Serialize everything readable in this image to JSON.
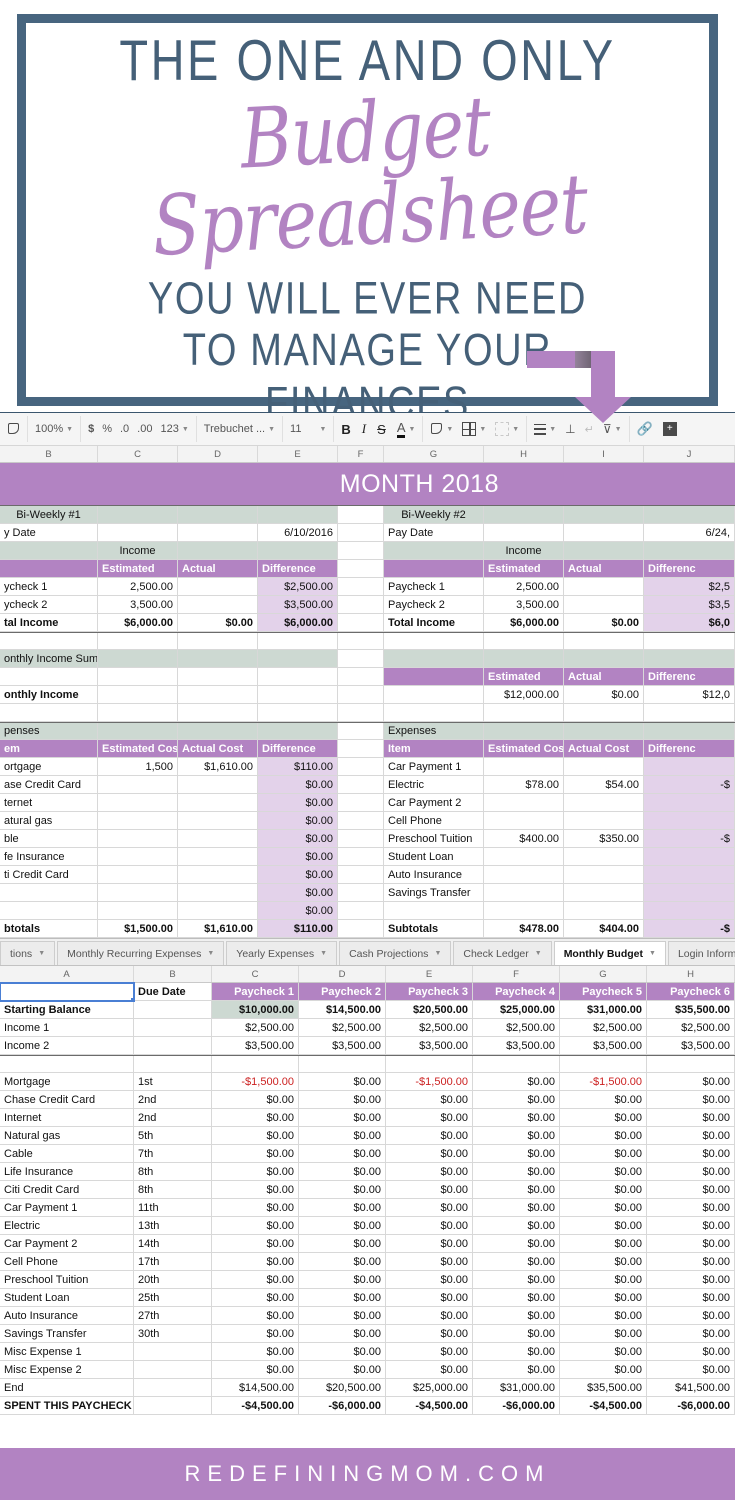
{
  "hero": {
    "line1": "THE ONE AND ONLY",
    "script": "Budget Spreadsheet",
    "line3_a": "YOU WILL EVER NEED",
    "line3_b": "TO MANAGE YOUR",
    "line3_c": "FINANCES"
  },
  "colors": {
    "accent_purple": "#b283c2",
    "light_purple": "#e3d2ea",
    "sage": "#cdd9d2",
    "navy": "#47657f",
    "negative_red": "#cc2222"
  },
  "toolbar": {
    "zoom": "100%",
    "currency": "$",
    "percent": "%",
    "dec_decrease": ".0",
    "dec_increase": ".00",
    "number_format": "123",
    "font": "Trebuchet ...",
    "font_size": "11",
    "bold": "B",
    "italic": "I",
    "strikethrough": "S",
    "text_color": "A"
  },
  "top_sheet": {
    "column_headers": [
      "B",
      "C",
      "D",
      "E",
      "F",
      "G",
      "H",
      "I",
      "J"
    ],
    "banner_title": "MONTH 2018",
    "left": {
      "section_title": "Bi-Weekly #1",
      "pay_date_label": "y Date",
      "pay_date_value": "6/10/2016",
      "income_label": "Income",
      "income_headers": [
        "Estimated",
        "Actual",
        "Difference"
      ],
      "income_rows": [
        {
          "item": "ycheck 1",
          "estimated": "2,500.00",
          "actual": "",
          "difference": "$2,500.00"
        },
        {
          "item": "ycheck 2",
          "estimated": "3,500.00",
          "actual": "",
          "difference": "$3,500.00"
        },
        {
          "item": "tal Income",
          "estimated": "$6,000.00",
          "actual": "$0.00",
          "difference": "$6,000.00"
        }
      ],
      "summary_title": "onthly Income Summary",
      "summary_label": "onthly Income",
      "expenses_title": "penses",
      "expense_headers": [
        "em",
        "Estimated Cost",
        "Actual Cost",
        "Difference"
      ],
      "expense_rows": [
        {
          "item": "ortgage",
          "estimated": "1,500",
          "actual": "$1,610.00",
          "difference": "$110.00"
        },
        {
          "item": "ase Credit Card",
          "estimated": "",
          "actual": "",
          "difference": "$0.00"
        },
        {
          "item": "ternet",
          "estimated": "",
          "actual": "",
          "difference": "$0.00"
        },
        {
          "item": "atural gas",
          "estimated": "",
          "actual": "",
          "difference": "$0.00"
        },
        {
          "item": "ble",
          "estimated": "",
          "actual": "",
          "difference": "$0.00"
        },
        {
          "item": "fe Insurance",
          "estimated": "",
          "actual": "",
          "difference": "$0.00"
        },
        {
          "item": "ti Credit Card",
          "estimated": "",
          "actual": "",
          "difference": "$0.00"
        },
        {
          "item": "",
          "estimated": "",
          "actual": "",
          "difference": "$0.00"
        },
        {
          "item": "",
          "estimated": "",
          "actual": "",
          "difference": "$0.00"
        }
      ],
      "subtotal_row": {
        "item": "btotals",
        "estimated": "$1,500.00",
        "actual": "$1,610.00",
        "difference": "$110.00"
      }
    },
    "right": {
      "section_title": "Bi-Weekly #2",
      "pay_date_label": "Pay Date",
      "pay_date_value": "6/24,",
      "income_label": "Income",
      "income_headers": [
        "Estimated",
        "Actual",
        "Differenc"
      ],
      "income_rows": [
        {
          "item": "Paycheck 1",
          "estimated": "2,500.00",
          "actual": "",
          "difference": "$2,5"
        },
        {
          "item": "Paycheck 2",
          "estimated": "3,500.00",
          "actual": "",
          "difference": "$3,5"
        },
        {
          "item": "Total Income",
          "estimated": "$6,000.00",
          "actual": "$0.00",
          "difference": "$6,0"
        }
      ],
      "summary_headers": [
        "Estimated",
        "Actual",
        "Differenc"
      ],
      "summary_values": {
        "estimated": "$12,000.00",
        "actual": "$0.00",
        "difference": "$12,0"
      },
      "expenses_title": "Expenses",
      "expense_headers": [
        "Item",
        "Estimated Cost",
        "Actual Cost",
        "Differenc"
      ],
      "expense_rows": [
        {
          "item": "Car Payment 1",
          "estimated": "",
          "actual": "",
          "difference": ""
        },
        {
          "item": "Electric",
          "estimated": "$78.00",
          "actual": "$54.00",
          "difference": "-$"
        },
        {
          "item": "Car Payment 2",
          "estimated": "",
          "actual": "",
          "difference": ""
        },
        {
          "item": "Cell Phone",
          "estimated": "",
          "actual": "",
          "difference": ""
        },
        {
          "item": "Preschool Tuition",
          "estimated": "$400.00",
          "actual": "$350.00",
          "difference": "-$"
        },
        {
          "item": "Student Loan",
          "estimated": "",
          "actual": "",
          "difference": ""
        },
        {
          "item": "Auto Insurance",
          "estimated": "",
          "actual": "",
          "difference": ""
        },
        {
          "item": "Savings Transfer",
          "estimated": "",
          "actual": "",
          "difference": ""
        },
        {
          "item": "",
          "estimated": "",
          "actual": "",
          "difference": ""
        }
      ],
      "subtotal_row": {
        "item": "Subtotals",
        "estimated": "$478.00",
        "actual": "$404.00",
        "difference": "-$"
      }
    }
  },
  "tabs": [
    {
      "label": "tions",
      "active": false
    },
    {
      "label": "Monthly Recurring Expenses",
      "active": false
    },
    {
      "label": "Yearly Expenses",
      "active": false
    },
    {
      "label": "Cash Projections",
      "active": false
    },
    {
      "label": "Check Ledger",
      "active": false
    },
    {
      "label": "Monthly Budget",
      "active": true
    },
    {
      "label": "Login Information",
      "active": false
    }
  ],
  "bottom_sheet": {
    "column_headers": [
      "A",
      "B",
      "C",
      "D",
      "E",
      "F",
      "G",
      "H"
    ],
    "header_row": [
      "",
      "Due Date",
      "Paycheck 1",
      "Paycheck 2",
      "Paycheck 3",
      "Paycheck 4",
      "Paycheck 5",
      "Paycheck 6"
    ],
    "rows": [
      {
        "item": "Starting Balance",
        "due": "",
        "vals": [
          "$10,000.00",
          "$14,500.00",
          "$20,500.00",
          "$25,000.00",
          "$31,000.00",
          "$35,500.00"
        ],
        "bold": true,
        "highlight_first": true
      },
      {
        "item": "Income 1",
        "due": "",
        "vals": [
          "$2,500.00",
          "$2,500.00",
          "$2,500.00",
          "$2,500.00",
          "$2,500.00",
          "$2,500.00"
        ]
      },
      {
        "item": "Income 2",
        "due": "",
        "vals": [
          "$3,500.00",
          "$3,500.00",
          "$3,500.00",
          "$3,500.00",
          "$3,500.00",
          "$3,500.00"
        ]
      },
      {
        "item": "",
        "due": "",
        "vals": [
          "",
          "",
          "",
          "",
          "",
          ""
        ],
        "spacer": true
      },
      {
        "item": "Mortgage",
        "due": "1st",
        "vals": [
          "-$1,500.00",
          "$0.00",
          "-$1,500.00",
          "$0.00",
          "-$1,500.00",
          "$0.00"
        ],
        "negflags": [
          true,
          false,
          true,
          false,
          true,
          false
        ]
      },
      {
        "item": "Chase Credit Card",
        "due": "2nd",
        "vals": [
          "$0.00",
          "$0.00",
          "$0.00",
          "$0.00",
          "$0.00",
          "$0.00"
        ]
      },
      {
        "item": "Internet",
        "due": "2nd",
        "vals": [
          "$0.00",
          "$0.00",
          "$0.00",
          "$0.00",
          "$0.00",
          "$0.00"
        ]
      },
      {
        "item": "Natural gas",
        "due": "5th",
        "vals": [
          "$0.00",
          "$0.00",
          "$0.00",
          "$0.00",
          "$0.00",
          "$0.00"
        ]
      },
      {
        "item": "Cable",
        "due": "7th",
        "vals": [
          "$0.00",
          "$0.00",
          "$0.00",
          "$0.00",
          "$0.00",
          "$0.00"
        ]
      },
      {
        "item": "Life Insurance",
        "due": "8th",
        "vals": [
          "$0.00",
          "$0.00",
          "$0.00",
          "$0.00",
          "$0.00",
          "$0.00"
        ]
      },
      {
        "item": "Citi Credit Card",
        "due": "8th",
        "vals": [
          "$0.00",
          "$0.00",
          "$0.00",
          "$0.00",
          "$0.00",
          "$0.00"
        ]
      },
      {
        "item": "Car Payment 1",
        "due": "11th",
        "vals": [
          "$0.00",
          "$0.00",
          "$0.00",
          "$0.00",
          "$0.00",
          "$0.00"
        ]
      },
      {
        "item": "Electric",
        "due": "13th",
        "vals": [
          "$0.00",
          "$0.00",
          "$0.00",
          "$0.00",
          "$0.00",
          "$0.00"
        ]
      },
      {
        "item": "Car Payment 2",
        "due": "14th",
        "vals": [
          "$0.00",
          "$0.00",
          "$0.00",
          "$0.00",
          "$0.00",
          "$0.00"
        ]
      },
      {
        "item": "Cell Phone",
        "due": "17th",
        "vals": [
          "$0.00",
          "$0.00",
          "$0.00",
          "$0.00",
          "$0.00",
          "$0.00"
        ]
      },
      {
        "item": "Preschool Tuition",
        "due": "20th",
        "vals": [
          "$0.00",
          "$0.00",
          "$0.00",
          "$0.00",
          "$0.00",
          "$0.00"
        ]
      },
      {
        "item": "Student Loan",
        "due": "25th",
        "vals": [
          "$0.00",
          "$0.00",
          "$0.00",
          "$0.00",
          "$0.00",
          "$0.00"
        ]
      },
      {
        "item": "Auto Insurance",
        "due": "27th",
        "vals": [
          "$0.00",
          "$0.00",
          "$0.00",
          "$0.00",
          "$0.00",
          "$0.00"
        ]
      },
      {
        "item": "Savings Transfer",
        "due": "30th",
        "vals": [
          "$0.00",
          "$0.00",
          "$0.00",
          "$0.00",
          "$0.00",
          "$0.00"
        ]
      },
      {
        "item": "Misc Expense 1",
        "due": "",
        "vals": [
          "$0.00",
          "$0.00",
          "$0.00",
          "$0.00",
          "$0.00",
          "$0.00"
        ]
      },
      {
        "item": "Misc Expense 2",
        "due": "",
        "vals": [
          "$0.00",
          "$0.00",
          "$0.00",
          "$0.00",
          "$0.00",
          "$0.00"
        ]
      },
      {
        "item": "End",
        "due": "",
        "vals": [
          "$14,500.00",
          "$20,500.00",
          "$25,000.00",
          "$31,000.00",
          "$35,500.00",
          "$41,500.00"
        ]
      },
      {
        "item": "SPENT THIS PAYCHECK",
        "due": "",
        "vals": [
          "-$4,500.00",
          "-$6,000.00",
          "-$4,500.00",
          "-$6,000.00",
          "-$4,500.00",
          "-$6,000.00"
        ],
        "bold": true
      }
    ]
  },
  "footer": {
    "site": "REDEFININGMOM.COM"
  }
}
